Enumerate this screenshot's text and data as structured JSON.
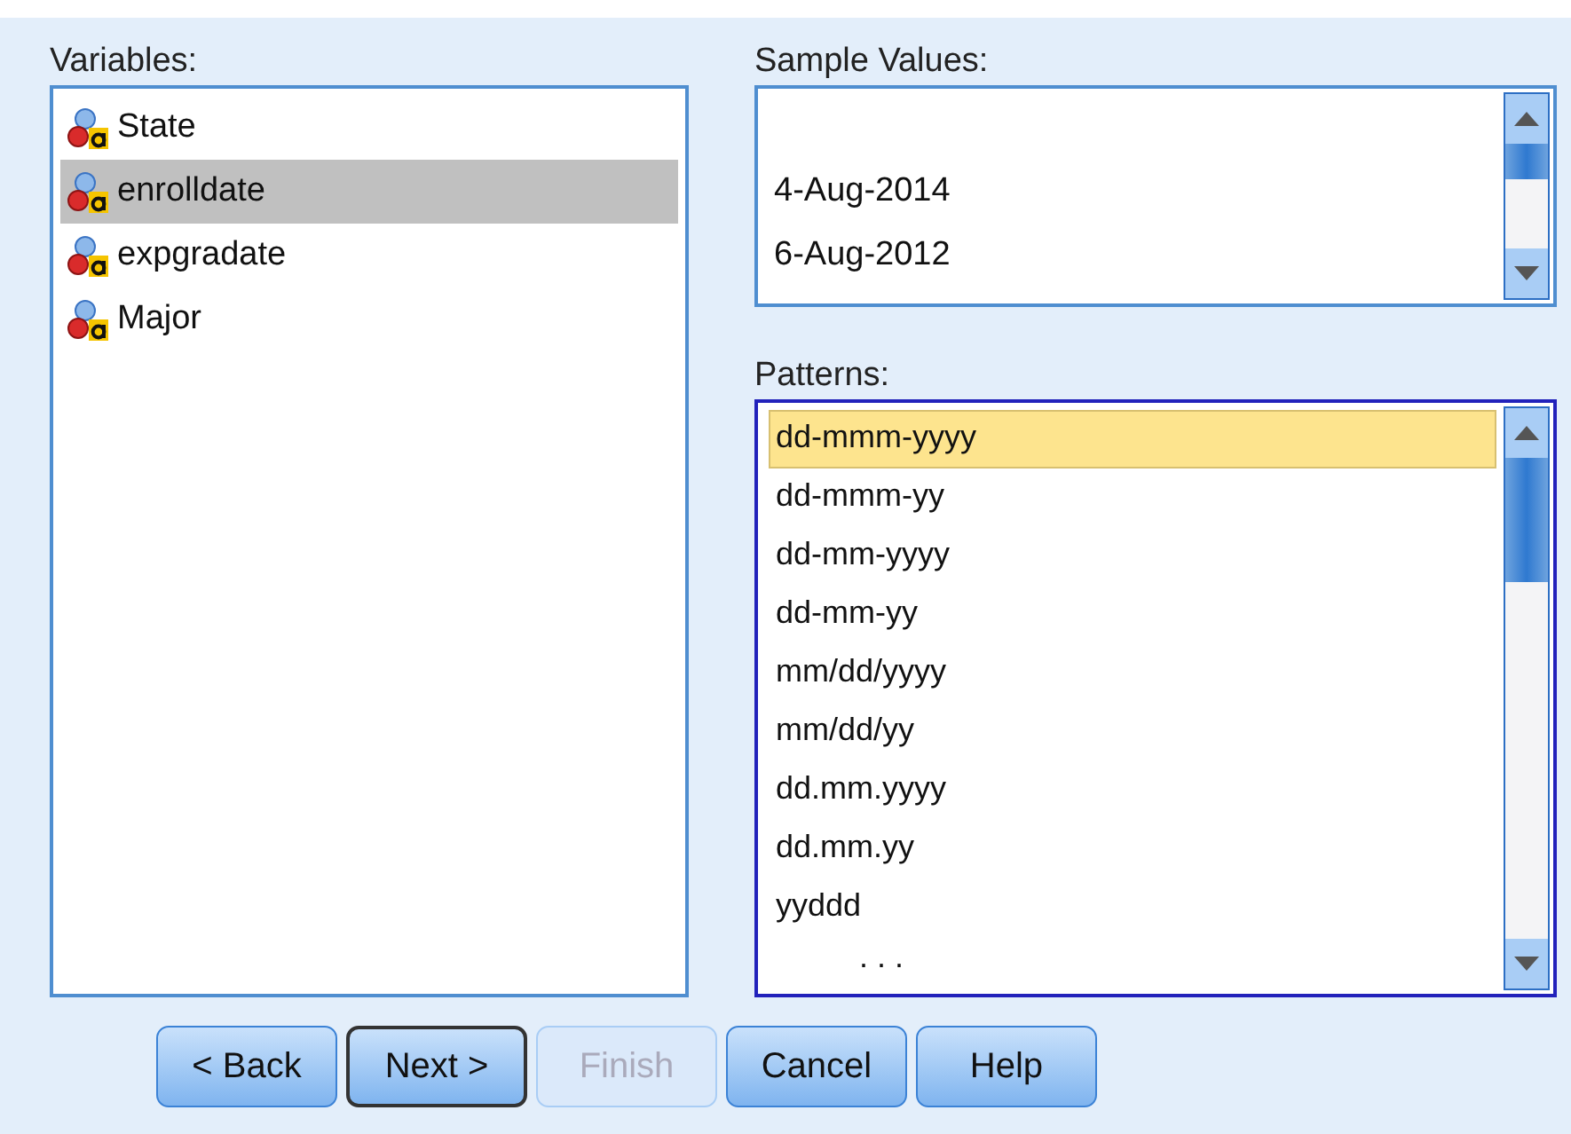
{
  "variables": {
    "label": "Variables:",
    "items": [
      {
        "name": "State",
        "selected": false
      },
      {
        "name": "enrolldate",
        "selected": true
      },
      {
        "name": "expgradate",
        "selected": false
      },
      {
        "name": "Major",
        "selected": false
      }
    ]
  },
  "sample_values": {
    "label": "Sample Values:",
    "values": [
      "4-Aug-2014",
      "6-Aug-2012"
    ]
  },
  "patterns": {
    "label": "Patterns:",
    "items": [
      {
        "text": "dd-mmm-yyyy",
        "selected": true
      },
      {
        "text": "dd-mmm-yy",
        "selected": false
      },
      {
        "text": "dd-mm-yyyy",
        "selected": false
      },
      {
        "text": "dd-mm-yy",
        "selected": false
      },
      {
        "text": "mm/dd/yyyy",
        "selected": false
      },
      {
        "text": "mm/dd/yy",
        "selected": false
      },
      {
        "text": "dd.mm.yyyy",
        "selected": false
      },
      {
        "text": "dd.mm.yy",
        "selected": false
      },
      {
        "text": "yyddd",
        "selected": false
      },
      {
        "text": ". . ."
      }
    ]
  },
  "buttons": [
    {
      "label": "< Back",
      "focused": false,
      "disabled": false
    },
    {
      "label": "Next >",
      "focused": true,
      "disabled": false
    },
    {
      "label": "Finish",
      "focused": false,
      "disabled": true
    },
    {
      "label": "Cancel",
      "focused": false,
      "disabled": false
    },
    {
      "label": "Help",
      "focused": false,
      "disabled": false
    }
  ]
}
